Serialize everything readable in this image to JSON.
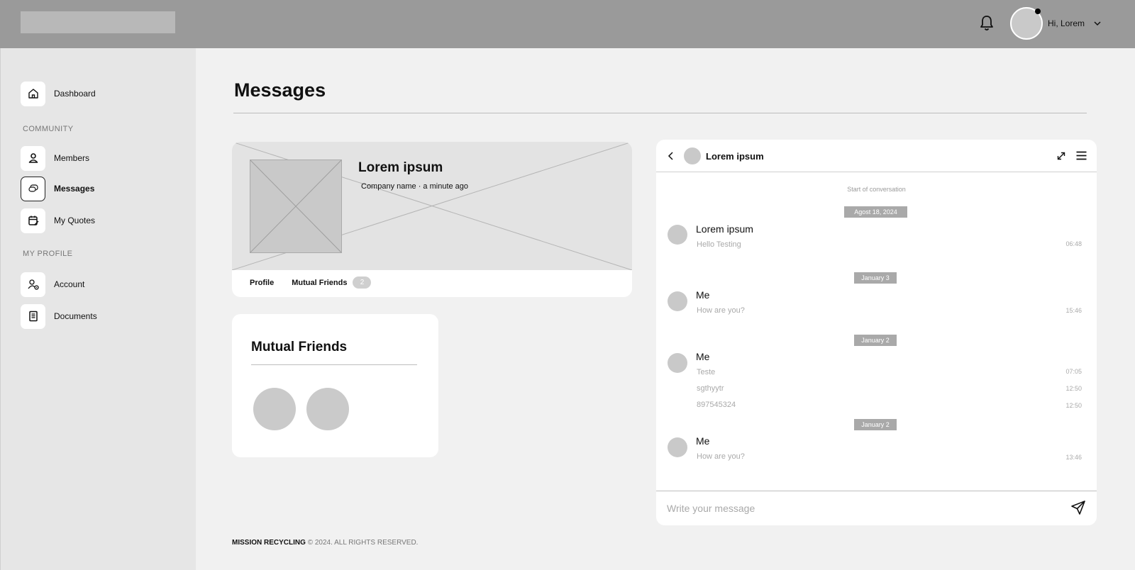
{
  "header": {
    "greeting": "Hi, Lorem",
    "bell_icon": "bell-icon",
    "dropdown_icon": "chevron-down-icon"
  },
  "sidebar": {
    "items": [
      {
        "label": "Dashboard",
        "icon": "home-icon"
      },
      {
        "label": "Members",
        "icon": "user-icon"
      },
      {
        "label": "Messages",
        "icon": "chat-icon"
      },
      {
        "label": "My Quotes",
        "icon": "calendar-edit-icon"
      },
      {
        "label": "Account",
        "icon": "user-settings-icon"
      },
      {
        "label": "Documents",
        "icon": "document-icon"
      }
    ],
    "sections": {
      "community": "COMMUNITY",
      "my_profile": "MY PROFILE"
    },
    "active": "Messages"
  },
  "main": {
    "title": "Messages",
    "profile": {
      "name": "Lorem ipsum",
      "meta": "Company name  · a minute ago",
      "tabs": {
        "profile": "Profile",
        "mutual": "Mutual Friends",
        "mutual_count": "2"
      }
    },
    "mutual_friends": {
      "title": "Mutual Friends"
    }
  },
  "chat": {
    "contact_name": "Lorem ipsum",
    "start_label": "Start of conversation",
    "dates": [
      "Agost 18, 2024",
      "January 3",
      "January 2",
      "January 2"
    ],
    "messages": [
      {
        "sender": "Lorem ipsum",
        "lines": [
          {
            "text": "Hello Testing",
            "time": "06:48"
          }
        ]
      },
      {
        "sender": "Me",
        "lines": [
          {
            "text": "How are you?",
            "time": "15:46"
          }
        ]
      },
      {
        "sender": "Me",
        "lines": [
          {
            "text": "Teste",
            "time": "07:05"
          },
          {
            "text": "sgthyytr",
            "time": "12:50"
          },
          {
            "text": "897545324",
            "time": "12:50"
          }
        ]
      },
      {
        "sender": "Me",
        "lines": [
          {
            "text": "How are you?",
            "time": "13:46"
          }
        ]
      }
    ],
    "composer_placeholder": "Write your message"
  },
  "footer": {
    "brand": "MISSION RECYCLING",
    "text": "© 2024. ALL RIGHTS RESERVED."
  }
}
